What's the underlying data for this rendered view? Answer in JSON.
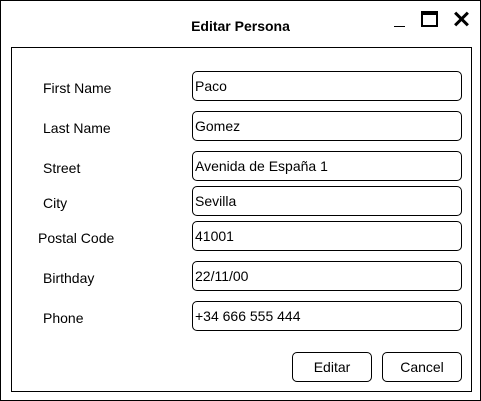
{
  "window": {
    "title": "Editar Persona",
    "controls": {
      "minimize_icon": "minimize-icon",
      "maximize_icon": "maximize-icon",
      "close_icon": "close-icon"
    }
  },
  "form": {
    "fields": [
      {
        "label": "First Name",
        "value": "Paco"
      },
      {
        "label": "Last Name",
        "value": "Gomez"
      },
      {
        "label": "Street",
        "value": "Avenida de España 1"
      },
      {
        "label": "City",
        "value": "Sevilla"
      },
      {
        "label": "Postal Code",
        "value": "41001"
      },
      {
        "label": "Birthday",
        "value": "22/11/00"
      },
      {
        "label": "Phone",
        "value": "+34 666 555 444"
      }
    ],
    "buttons": {
      "edit": "Editar",
      "cancel": "Cancel"
    }
  }
}
